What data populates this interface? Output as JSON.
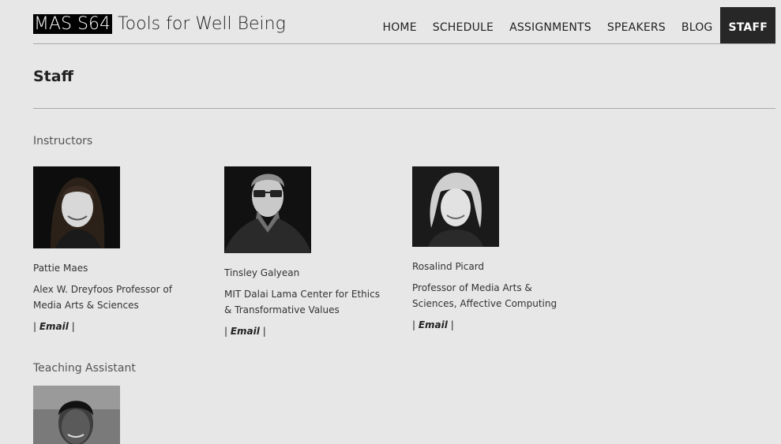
{
  "site": {
    "code": "MAS S64",
    "title": "Tools for Well Being"
  },
  "nav": [
    {
      "label": "HOME"
    },
    {
      "label": "SCHEDULE"
    },
    {
      "label": "ASSIGNMENTS"
    },
    {
      "label": "SPEAKERS"
    },
    {
      "label": "BLOG"
    },
    {
      "label": "STAFF",
      "active": true
    }
  ],
  "page": {
    "title": "Staff"
  },
  "instructors": {
    "heading": "Instructors",
    "people": [
      {
        "name": "Pattie Maes",
        "role": "Alex W. Dreyfoos Professor  of Media Arts & Sciences",
        "email_pre": "| ",
        "email_label": "Email",
        "email_post": " |"
      },
      {
        "name": "Tinsley Galyean",
        "role": "MIT  Dalai Lama Center for Ethics & Transformative Values",
        "email_pre": "| ",
        "email_label": "Email",
        "email_post": " |"
      },
      {
        "name": "Rosalind Picard",
        "role": "Professor of Media Arts & Sciences, Affective Computing",
        "email_pre": "| ",
        "email_label": "Email",
        "email_post": " |"
      }
    ]
  },
  "teaching_assistant": {
    "heading": "Teaching Assistant"
  }
}
